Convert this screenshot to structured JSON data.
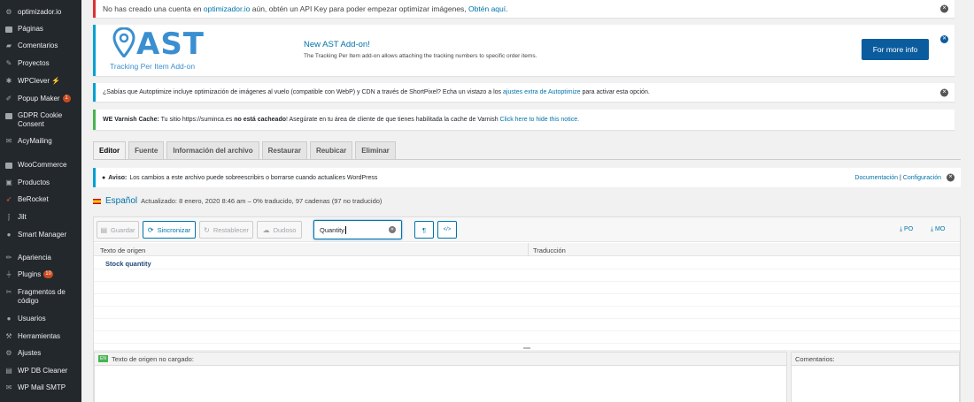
{
  "sidebar": {
    "items": [
      {
        "label": "optimizador.io",
        "icon": "gear-icon"
      },
      {
        "label": "Páginas",
        "icon": "pages-icon"
      },
      {
        "label": "Comentarios",
        "icon": "comment-icon"
      },
      {
        "label": "Proyectos",
        "icon": "pin-icon"
      },
      {
        "label": "WPClever",
        "icon": "star-icon"
      },
      {
        "label": "Popup Maker",
        "icon": "popup-icon",
        "badge": "1"
      },
      {
        "label": "GDPR Cookie Consent",
        "icon": "cookie-icon"
      },
      {
        "label": "AcyMailing",
        "icon": "mail-icon"
      },
      {
        "label": "WooCommerce",
        "icon": "woo-icon"
      },
      {
        "label": "Productos",
        "icon": "box-icon"
      },
      {
        "label": "BeRocket",
        "icon": "rocket-icon"
      },
      {
        "label": "Jilt",
        "icon": "jilt-icon"
      },
      {
        "label": "Smart Manager",
        "icon": "user-icon"
      },
      {
        "label": "Apariencia",
        "icon": "brush-icon"
      },
      {
        "label": "Plugins",
        "icon": "plug-icon",
        "badge": "10"
      },
      {
        "label": "Fragmentos de código",
        "icon": "scissors-icon"
      },
      {
        "label": "Usuarios",
        "icon": "users-icon"
      },
      {
        "label": "Herramientas",
        "icon": "wrench-icon"
      },
      {
        "label": "Ajustes",
        "icon": "settings-icon"
      },
      {
        "label": "WP DB Cleaner",
        "icon": "db-icon"
      },
      {
        "label": "WP Mail SMTP",
        "icon": "envelope-icon"
      }
    ]
  },
  "notices": {
    "api": {
      "pre": "No has creado una cuenta en",
      "link1": "optimizador.io",
      "mid": "aún, obtén un API Key para poder empezar optimizar imágenes,",
      "link2": "Obtén aquí",
      "post": "."
    },
    "ast": {
      "logo_word": "AST",
      "logo_sub": "Tracking Per Item Add-on",
      "title": "New AST Add-on!",
      "desc": "The Tracking Per Item add-on allows attaching the tracking numbers to specific order items.",
      "button": "For more info"
    },
    "autoptimize": {
      "pre": "¿Sabías que Autoptimize incluye optimización de imágenes al vuelo (compatible con WebP) y CDN a través de ShortPixel? Echa un vistazo a los",
      "link": "ajustes extra de Autoptimize",
      "post": "para activar esta opción."
    },
    "varnish": {
      "label": "WE Varnish Cache:",
      "pre": "Tu sitio https://suminca.es",
      "bold": "no está cacheado",
      "mid": "! Asegúrate en tu área de cliente de que tienes habilitada la cache de Varnish",
      "link": "Click here to hide this notice."
    }
  },
  "tabs": [
    "Editor",
    "Fuente",
    "Información del archivo",
    "Restaurar",
    "Reubicar",
    "Eliminar"
  ],
  "aviso": {
    "label": "Aviso:",
    "text": "Los cambios a este archivo puede sobreescribirs o borrarse cuando actualices WordPress",
    "link1": "Documentación",
    "sep": "|",
    "link2": "Configuración"
  },
  "language": {
    "name": "Español",
    "status": "Actualizado: 8 enero, 2020 8:46 am – 0% traducido, 97 cadenas (97 no traducido)"
  },
  "toolbar": {
    "save": "Guardar",
    "sync": "Sincronizar",
    "revert": "Restablecer",
    "fuzzy": "Dudoso",
    "search_value": "Quantity",
    "pilcrow": "¶",
    "code": "</>",
    "po": "PO",
    "mo": "MO"
  },
  "table": {
    "source_header": "Texto de origen",
    "translation_header": "Traducción",
    "rows": [
      "Stock quantity"
    ]
  },
  "lower": {
    "en_tag": "EN",
    "source_pane": "Texto de origen no cargado:",
    "comments_pane": "Comentarios:"
  }
}
